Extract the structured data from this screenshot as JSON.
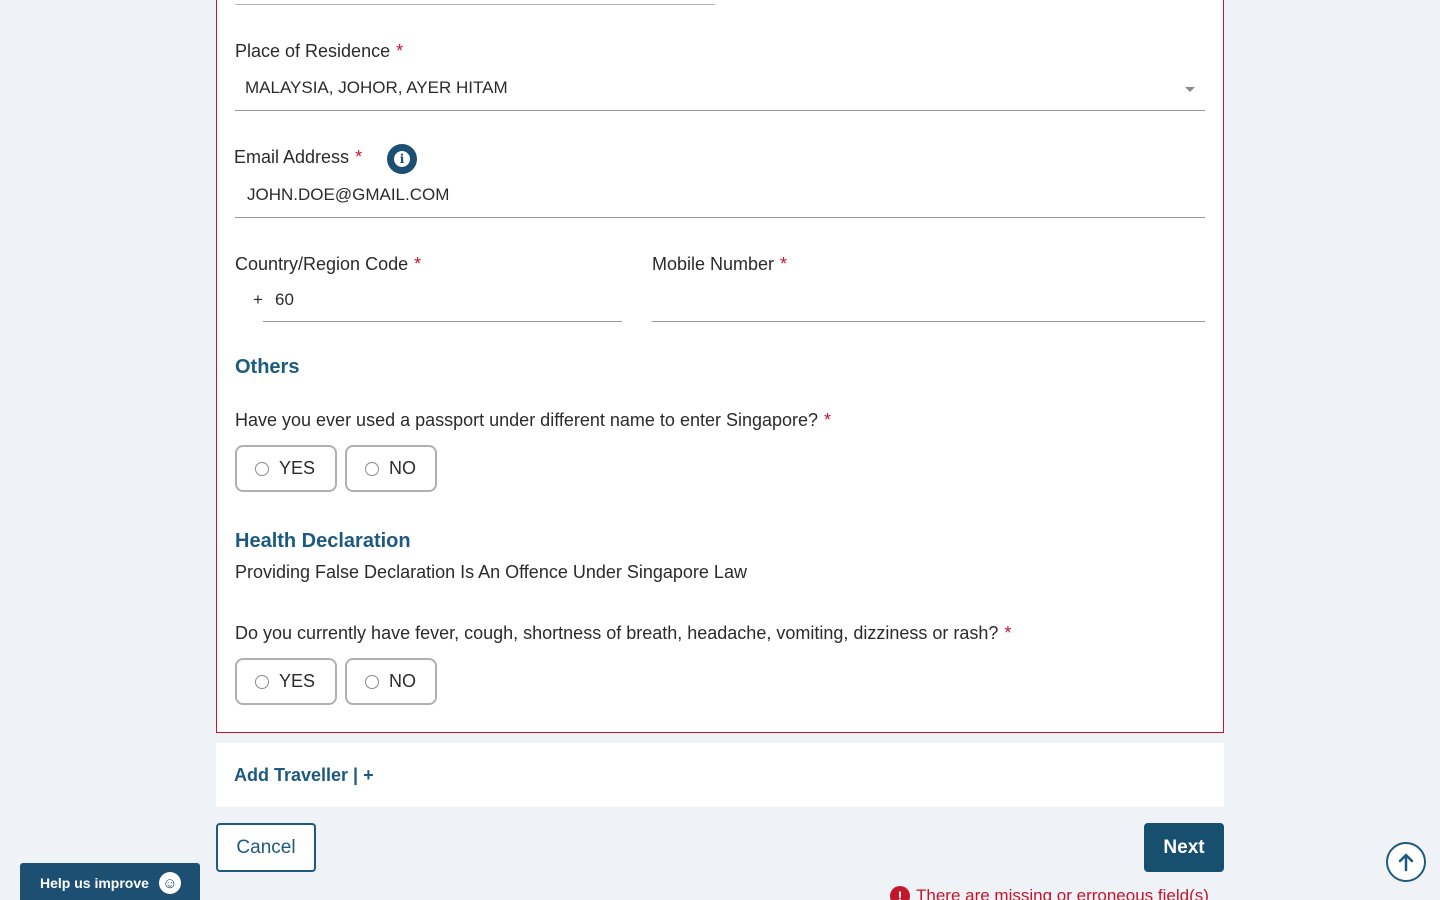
{
  "residence": {
    "label": "Place of Residence",
    "value": "MALAYSIA, JOHOR, AYER HITAM"
  },
  "email": {
    "label": "Email Address",
    "value": "JOHN.DOE@GMAIL.COM"
  },
  "country_code": {
    "label": "Country/Region Code",
    "prefix": "+",
    "value": "60"
  },
  "mobile": {
    "label": "Mobile Number",
    "value": ""
  },
  "required_mark": "*",
  "others": {
    "title": "Others",
    "question": "Have you ever used a passport under different name to enter Singapore?",
    "yes": "YES",
    "no": "NO"
  },
  "health": {
    "title": "Health Declaration",
    "subtitle": "Providing False Declaration Is An Offence Under Singapore Law",
    "question": "Do you currently have fever, cough, shortness of breath, headache, vomiting, dizziness or rash?",
    "yes": "YES",
    "no": "NO"
  },
  "add_traveller": "Add Traveller | +",
  "buttons": {
    "cancel": "Cancel",
    "next": "Next"
  },
  "error_message": "There are missing or erroneous field(s)",
  "help_widget": "Help us improve",
  "colors": {
    "primary": "#1d5a80",
    "error": "#c4162a"
  }
}
